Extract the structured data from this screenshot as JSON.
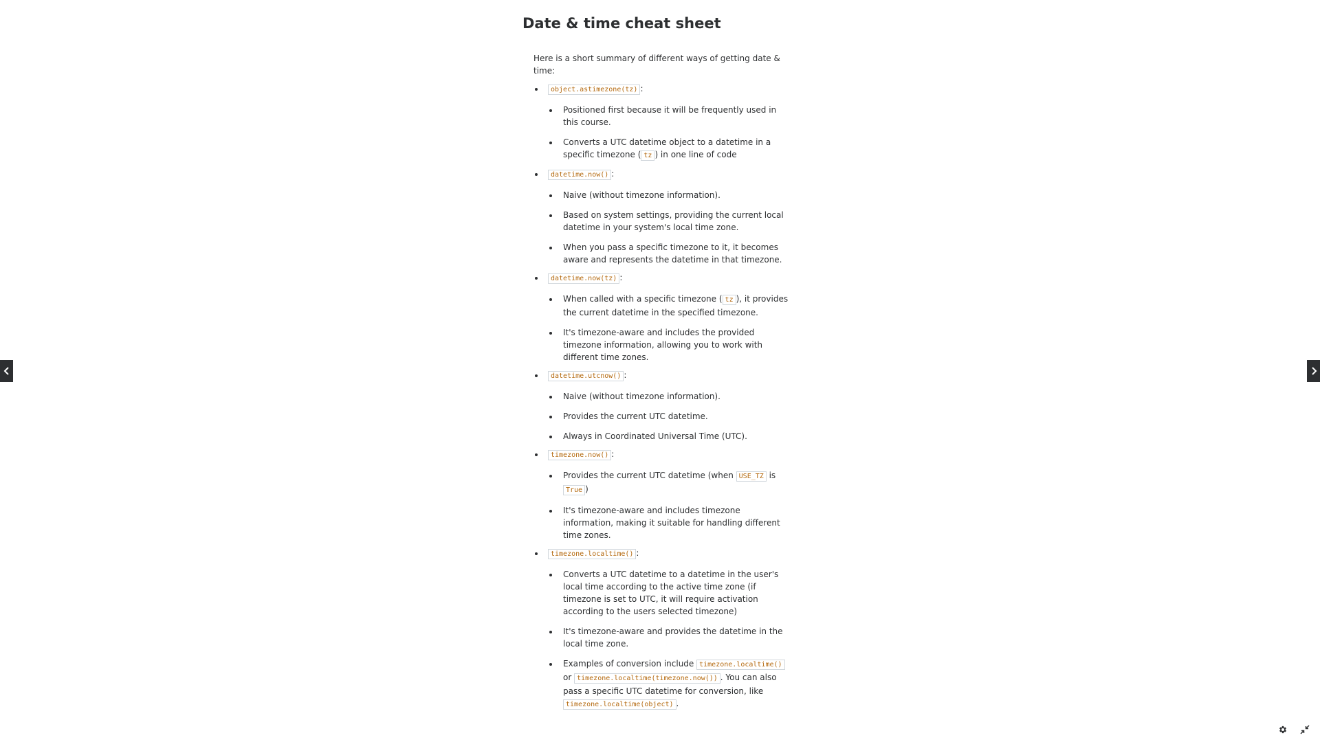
{
  "title": "Date & time cheat sheet",
  "intro": "Here is a short summary of different ways of getting date & time:",
  "sections": [
    {
      "code": "object.astimezone(tz)",
      "suffix": ":",
      "items": [
        [
          {
            "t": "Positioned first because it will be frequently used in this course."
          }
        ],
        [
          {
            "t": "Converts a UTC datetime object to a datetime in a specific timezone ("
          },
          {
            "c": "tz"
          },
          {
            "t": ") in one line of code"
          }
        ]
      ]
    },
    {
      "code": "datetime.now()",
      "suffix": ":",
      "items": [
        [
          {
            "t": "Naive (without timezone information)."
          }
        ],
        [
          {
            "t": "Based on system settings, providing the current local datetime in your system's local time zone."
          }
        ],
        [
          {
            "t": "When you pass a specific timezone to it, it becomes aware and represents the datetime in that timezone."
          }
        ]
      ]
    },
    {
      "code": "datetime.now(tz)",
      "suffix": ":",
      "items": [
        [
          {
            "t": "When called with a specific timezone ("
          },
          {
            "c": "tz"
          },
          {
            "t": "), it provides the current datetime in the specified timezone."
          }
        ],
        [
          {
            "t": "It's timezone-aware and includes the provided timezone information, allowing you to work with different time zones."
          }
        ]
      ]
    },
    {
      "code": "datetime.utcnow()",
      "suffix": ":",
      "items": [
        [
          {
            "t": "Naive (without timezone information)."
          }
        ],
        [
          {
            "t": "Provides the current UTC datetime."
          }
        ],
        [
          {
            "t": "Always in Coordinated Universal Time (UTC)."
          }
        ]
      ]
    },
    {
      "code": "timezone.now()",
      "suffix": ":",
      "items": [
        [
          {
            "t": "Provides the current UTC datetime (when "
          },
          {
            "c": "USE_TZ"
          },
          {
            "t": " is "
          },
          {
            "c": "True"
          },
          {
            "t": ")"
          }
        ],
        [
          {
            "t": "It's timezone-aware and includes timezone information, making it suitable for handling different time zones."
          }
        ]
      ]
    },
    {
      "code": "timezone.localtime()",
      "suffix": ":",
      "items": [
        [
          {
            "t": "Converts a UTC datetime to a datetime in the user's local time according to the active time zone (if timezone is set to UTC, it will require activation according to the users selected timezone)"
          }
        ],
        [
          {
            "t": "It's timezone-aware and provides the datetime in the local time zone."
          }
        ],
        [
          {
            "t": "Examples of conversion include "
          },
          {
            "c": "timezone.localtime()"
          },
          {
            "t": " or "
          },
          {
            "c": "timezone.localtime(timezone.now())"
          },
          {
            "t": ". You can also pass a specific UTC datetime for conversion, like "
          },
          {
            "c": "timezone.localtime(object)"
          },
          {
            "t": "."
          }
        ]
      ]
    }
  ],
  "nav": {
    "prev_icon": "chevron-left-icon",
    "next_icon": "chevron-right-icon"
  },
  "controls": {
    "settings_icon": "gear-icon",
    "exit_fullscreen_icon": "collapse-icon"
  },
  "colors": {
    "text": "#2d2f31",
    "code": "#b4690e",
    "code_border": "#d1d7dc",
    "nav_bg": "#2d2f31"
  }
}
